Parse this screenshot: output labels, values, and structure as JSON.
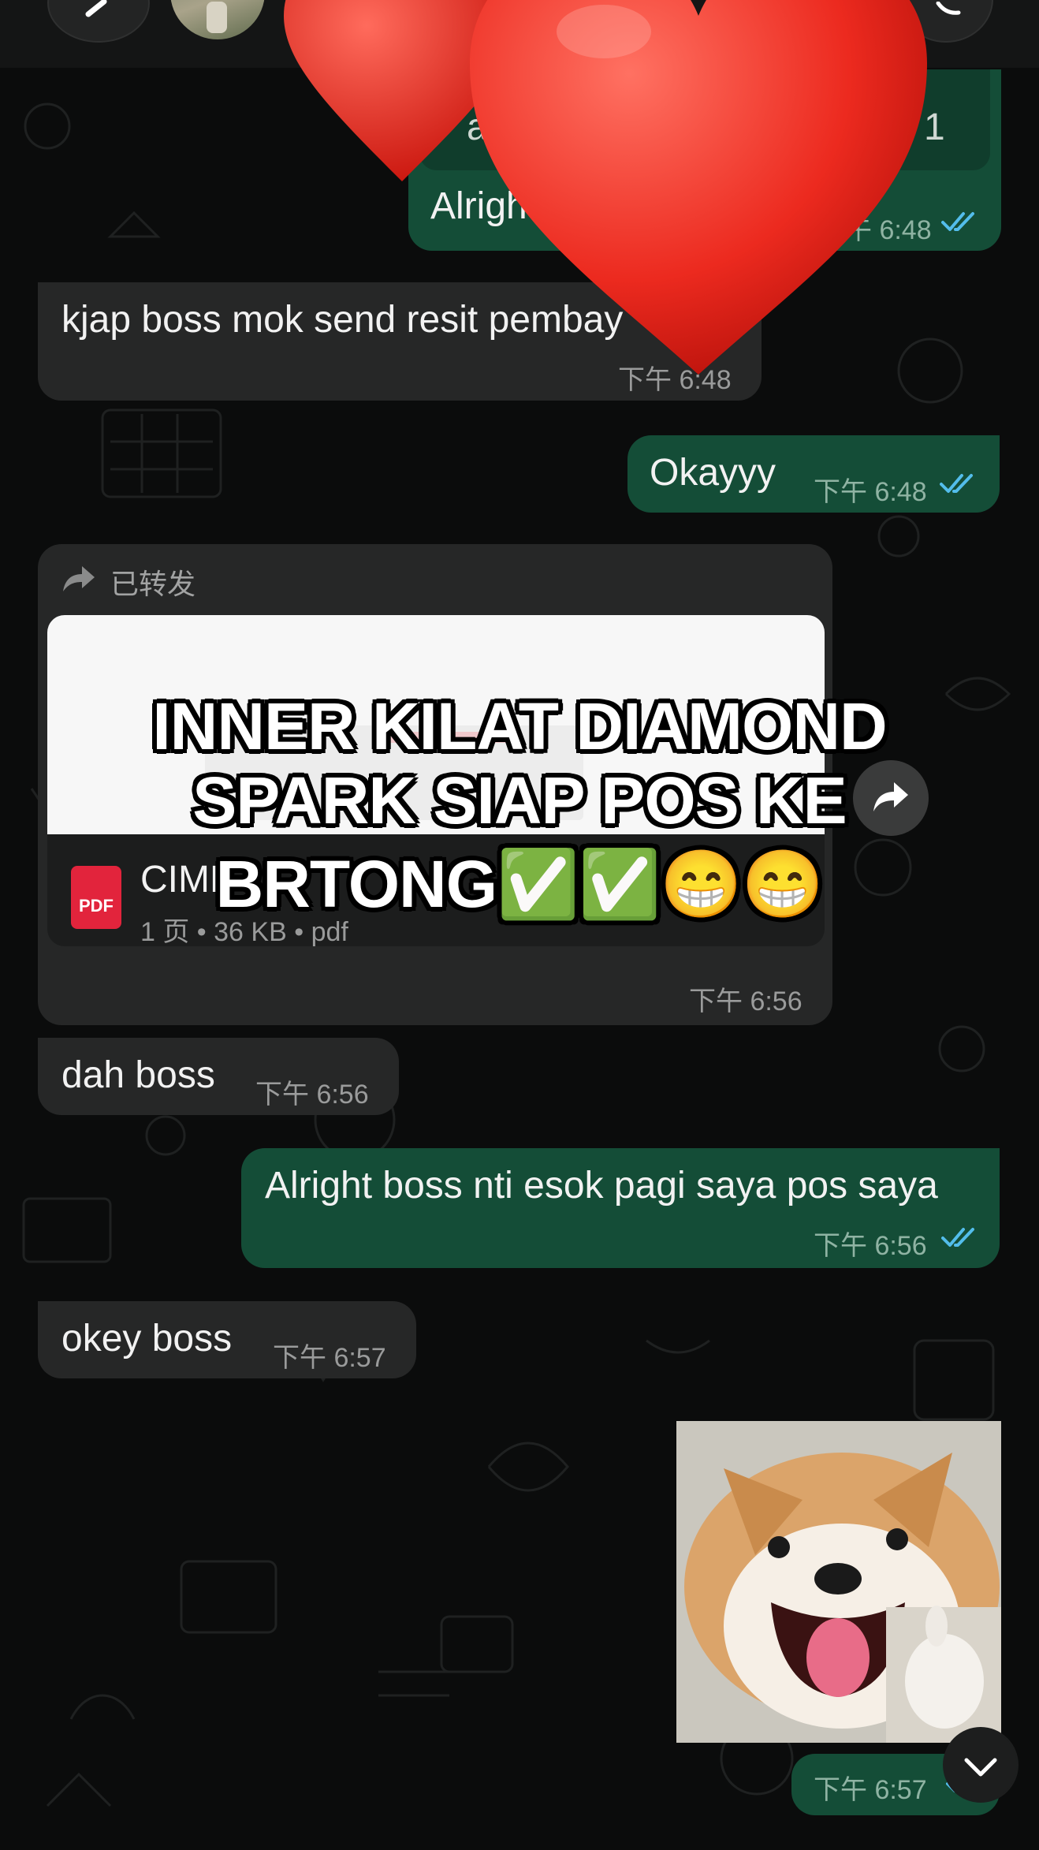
{
  "colors": {
    "background": "#0b0c0c",
    "incoming_bubble": "#262727",
    "outgoing_bubble": "#144d37",
    "read_ticks": "#53bdeb",
    "heart": "#e8261c"
  },
  "icons": [
    "back-icon",
    "avatar",
    "call-icon",
    "heart-icon",
    "forward-icon",
    "pdf-icon",
    "double-check-icon",
    "chevron-down-icon"
  ],
  "messages": [
    {
      "text": "Alright",
      "time": "下午 6:48",
      "dir": "out",
      "status": "read"
    },
    {
      "text": "kjap boss mok send resit pembay",
      "time": "下午 6:48",
      "dir": "in"
    },
    {
      "text": "Okayyy",
      "time": "下午 6:48",
      "dir": "out",
      "status": "read"
    },
    {
      "text": "dah boss",
      "time": "下午 6:56",
      "dir": "in"
    },
    {
      "text": "Alright boss nti esok pagi saya pos saya",
      "time": "下午 6:56",
      "dir": "out",
      "status": "read"
    },
    {
      "text": "okey boss",
      "time": "下午 6:57",
      "dir": "in"
    }
  ],
  "quoted_partial": {
    "left_char": "a",
    "right_char": "1"
  },
  "forwarded": {
    "label": "已转发",
    "file_name": "CIMB",
    "file_name_tail": "f",
    "file_meta": "1 页 • 36 KB • pdf",
    "pdf_badge": "PDF",
    "time": "下午 6:56"
  },
  "sticker": {
    "time": "下午 6:57",
    "status": "read"
  },
  "overlay": {
    "line1": "INNER KILAT DIAMOND",
    "line2": "SPARK SIAP POS KE",
    "line3": "BRTONG✅✅😁😁"
  }
}
